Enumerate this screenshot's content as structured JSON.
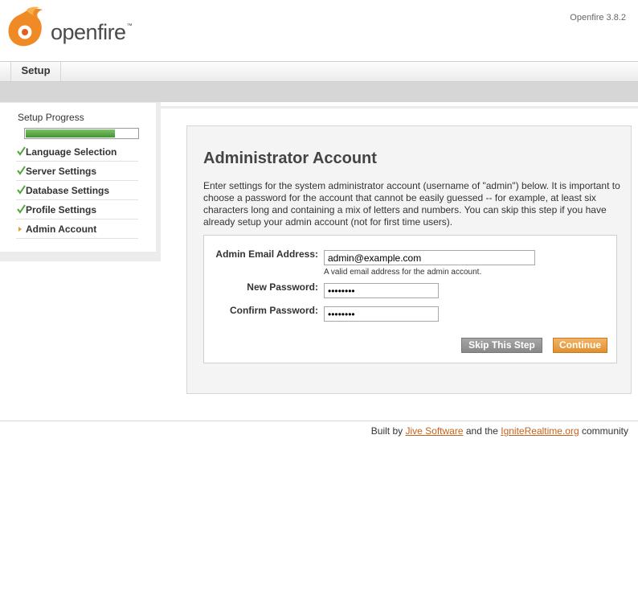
{
  "header": {
    "brand": "openfire",
    "trademark": "™",
    "version": "Openfire 3.8.2",
    "logo_icon": "openfire-flame-logo"
  },
  "nav": {
    "tabs": [
      {
        "label": "Setup",
        "active": true
      }
    ]
  },
  "sidebar": {
    "title": "Setup Progress",
    "progress": 0.8,
    "progress_color": "#4fa43b",
    "steps": [
      {
        "label": "Language Selection",
        "status": "done",
        "icon": "checkmark-icon"
      },
      {
        "label": "Server Settings",
        "status": "done",
        "icon": "checkmark-icon"
      },
      {
        "label": "Database Settings",
        "status": "done",
        "icon": "checkmark-icon"
      },
      {
        "label": "Profile Settings",
        "status": "done",
        "icon": "checkmark-icon"
      },
      {
        "label": "Admin Account",
        "status": "current",
        "icon": "arrow-right-icon"
      }
    ]
  },
  "main": {
    "title": "Administrator Account",
    "description": "Enter settings for the system administrator account (username of \"admin\") below. It is important to choose a password for the account that cannot be easily guessed -- for example, at least six characters long and containing a mix of letters and numbers. You can skip this step if you have already setup your admin account (not for first time users).",
    "form": {
      "email_label": "Admin Email Address:",
      "email_value": "admin@example.com",
      "email_hint": "A valid email address for the admin account.",
      "password_label": "New Password:",
      "password_value": "••••••••",
      "confirm_label": "Confirm Password:",
      "confirm_value": "••••••••",
      "skip_button": "Skip This Step",
      "continue_button": "Continue"
    }
  },
  "footer": {
    "prefix": "Built by",
    "link1": "Jive Software",
    "middle": "and the",
    "link2": "IgniteRealtime.org",
    "suffix": "community"
  },
  "colors": {
    "accent": "#e0902f",
    "link": "#c6621c",
    "check": "#4fa43b"
  }
}
